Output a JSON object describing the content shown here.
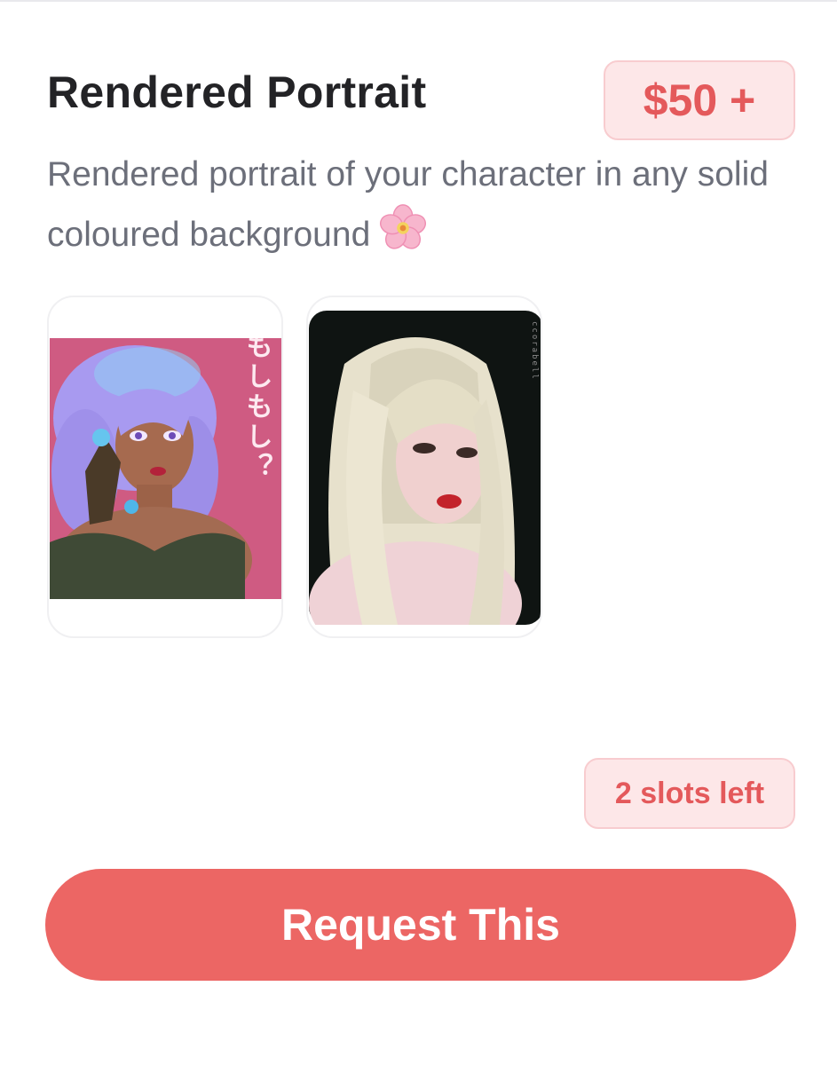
{
  "product": {
    "title": "Rendered Portrait",
    "price": "$50 +",
    "description": "Rendered portrait of your character in any solid coloured background",
    "description_emoji": "cherry-blossom-icon",
    "slots": "2 slots left"
  },
  "gallery": {
    "images": [
      {
        "name": "portrait-example-purple-hair",
        "caption": "もしもし？"
      },
      {
        "name": "portrait-example-blonde-hair",
        "watermark": "ccorabell"
      }
    ]
  },
  "actions": {
    "request_label": "Request This"
  },
  "colors": {
    "accent": "#ec6664",
    "badge_background": "#fde7e8",
    "badge_text": "#e4595b",
    "title": "#232326",
    "description": "#6c6f7a"
  }
}
